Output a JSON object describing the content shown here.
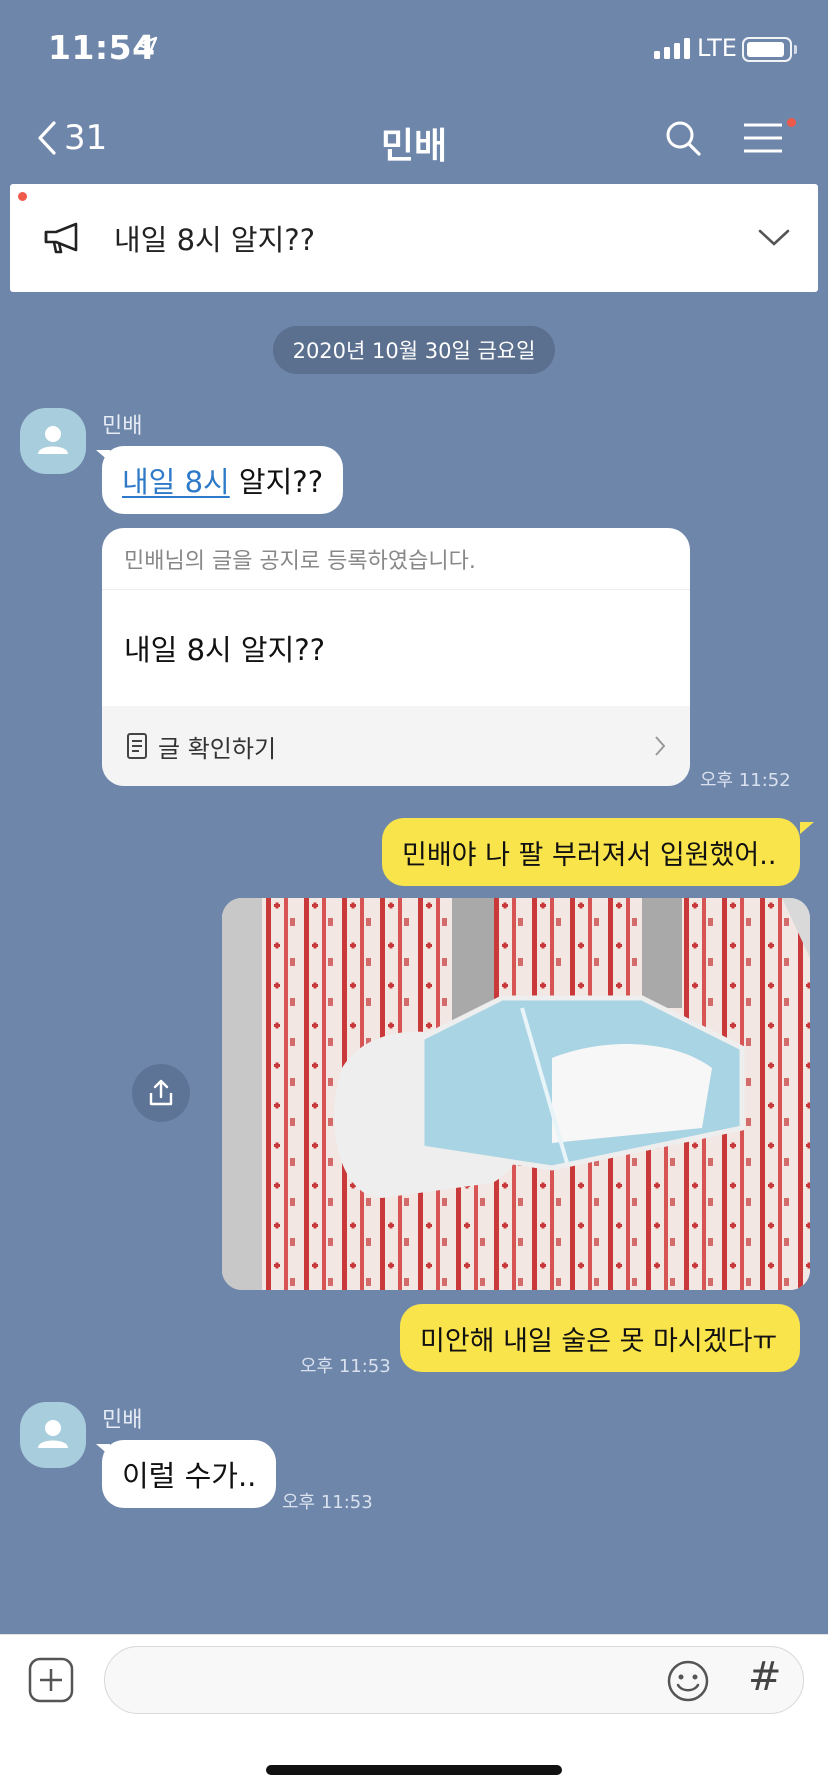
{
  "status_bar": {
    "time": "11:54",
    "network": "LTE"
  },
  "nav": {
    "back_count": "31",
    "title": "민배"
  },
  "notice": {
    "text": "내일 8시 알지??"
  },
  "date_divider": "2020년 10월 30일 금요일",
  "messages": {
    "m1": {
      "sender": "민배",
      "link_text": "내일 8시",
      "rest_text": " 알지??"
    },
    "card": {
      "header": "민배님의 글을 공지로 등록하였습니다.",
      "body": "내일 8시 알지??",
      "action": "글 확인하기",
      "time": "오후 11:52"
    },
    "m2": {
      "text": "민배야 나 팔 부러져서 입원했어.."
    },
    "m3": {
      "text": "미안해 내일 술은 못 마시겠다ㅠ",
      "time": "오후 11:53"
    },
    "m4": {
      "sender": "민배",
      "text": "이럴 수가..",
      "time": "오후 11:53"
    }
  },
  "input": {
    "value": "",
    "hash_label": "#"
  },
  "colors": {
    "background": "#6e86aa",
    "my_bubble": "#fae44b",
    "their_bubble": "#ffffff",
    "link": "#2f7ac8",
    "badge": "#f05a4a"
  },
  "icons": [
    "location-arrow-icon",
    "signal-icon",
    "battery-icon",
    "back-chevron-icon",
    "search-icon",
    "menu-icon",
    "megaphone-icon",
    "chevron-down-icon",
    "avatar-icon",
    "document-icon",
    "chevron-right-icon",
    "share-icon",
    "plus-icon",
    "emoji-icon"
  ]
}
